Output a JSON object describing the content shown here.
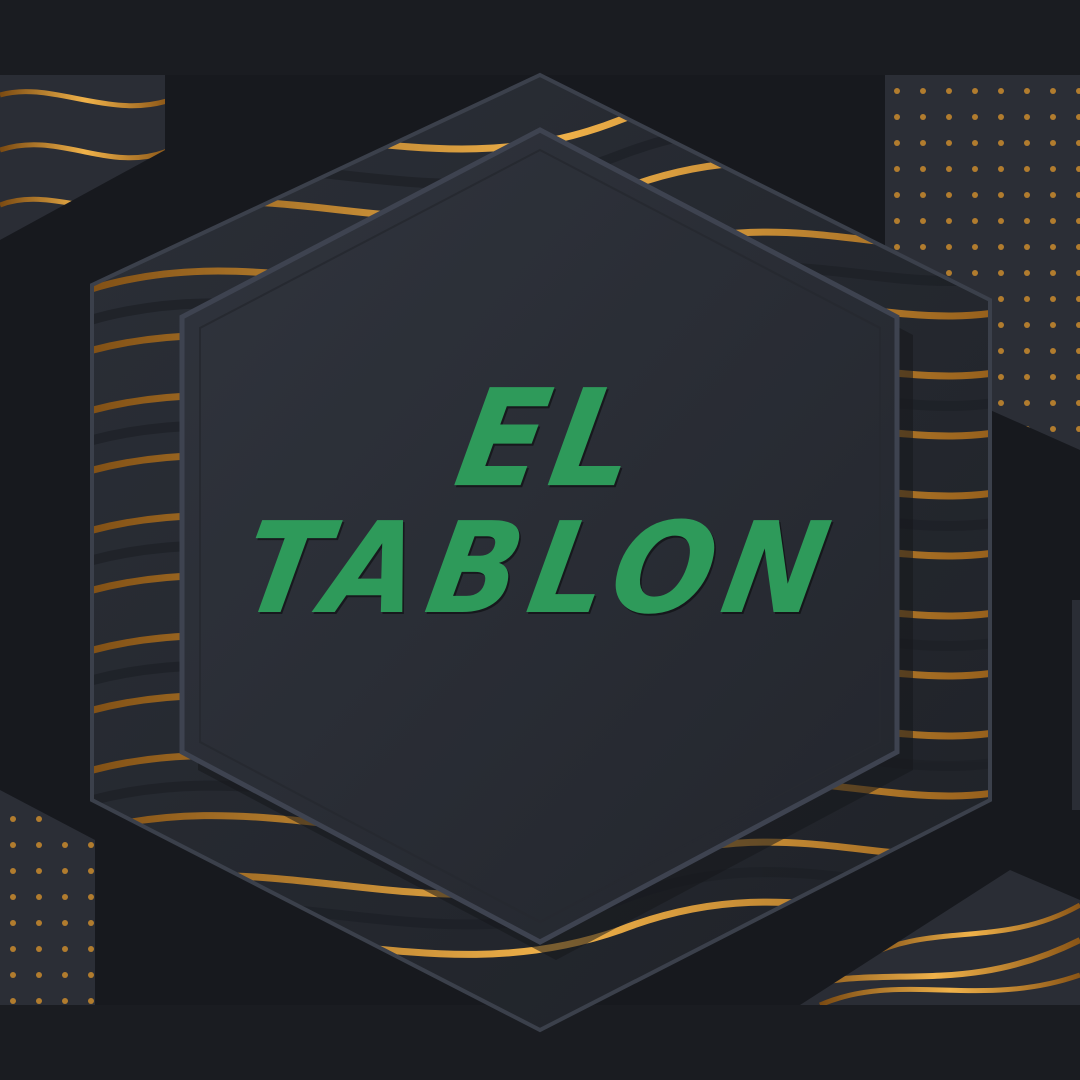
{
  "logo": {
    "line1": "EL",
    "line2": "TABLON"
  },
  "colors": {
    "background": "#17191e",
    "hexagon": "#2a2e37",
    "hexagon_edge": "#3a3f4a",
    "gold": "#d9952e",
    "text": "#2e9a5a"
  }
}
